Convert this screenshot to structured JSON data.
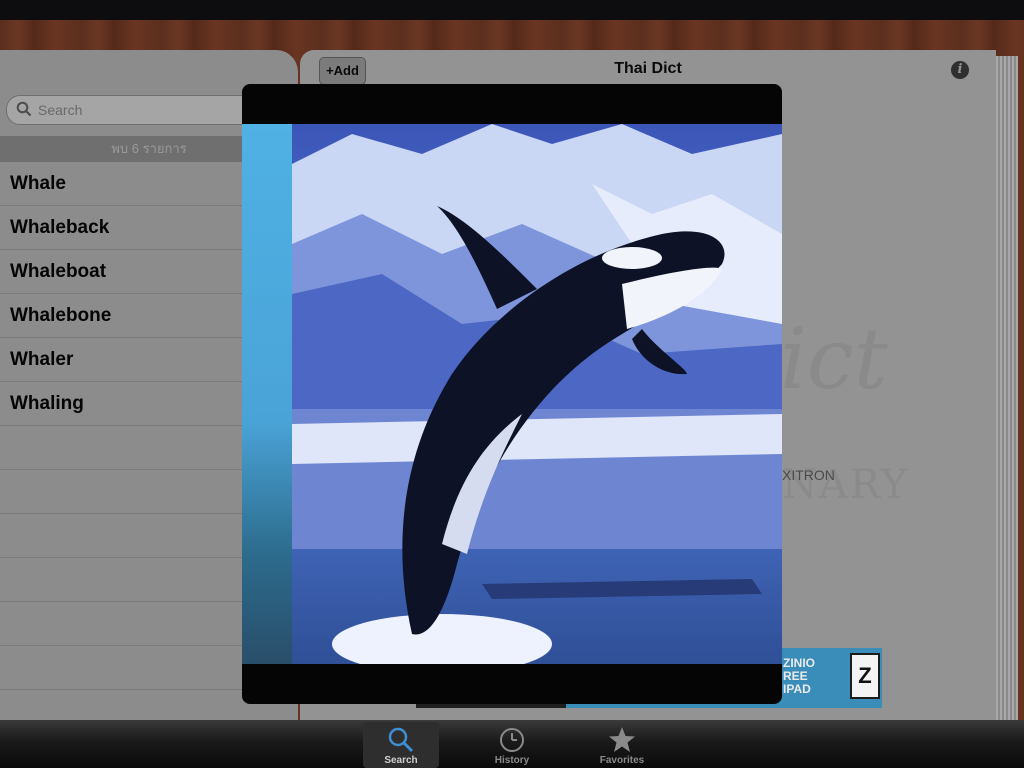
{
  "app": {
    "title": "Thai Dict"
  },
  "toolbar": {
    "add_label": "+Add"
  },
  "search": {
    "placeholder": "Search"
  },
  "results": {
    "header": "พบ 6 รายการ",
    "items": [
      "Whale",
      "Whaleback",
      "Whaleboat",
      "Whalebone",
      "Whaler",
      "Whaling"
    ]
  },
  "page": {
    "publisher": "XITRON"
  },
  "ad": {
    "text": "ZINIO\nREE\nIPAD"
  },
  "modal": {
    "image": "orca-breaching-photo"
  },
  "tabs": [
    {
      "label": "Search",
      "icon": "search-icon",
      "selected": true
    },
    {
      "label": "History",
      "icon": "clock-icon",
      "selected": false
    },
    {
      "label": "Favorites",
      "icon": "star-icon",
      "selected": false
    }
  ],
  "colors": {
    "accent": "#3a8db8",
    "tab_selected": "#cfcfcf",
    "tab_inactive": "#8a8a8a"
  }
}
